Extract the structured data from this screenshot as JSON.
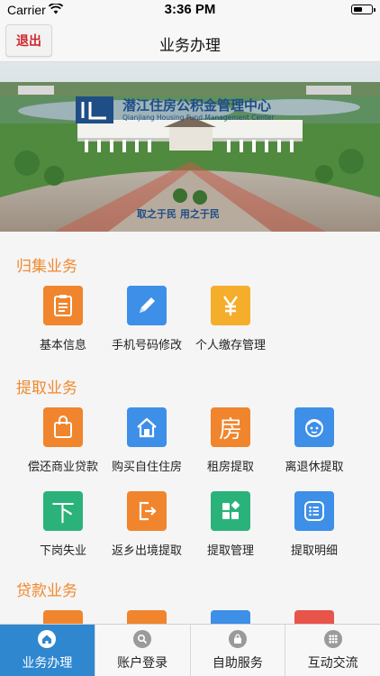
{
  "status_bar": {
    "carrier": "Carrier",
    "time": "3:36 PM"
  },
  "nav": {
    "back_label": "退出",
    "title": "业务办理"
  },
  "banner": {
    "center_name": "潜江住房公积金管理中心",
    "center_name_en": "Qianjiang Housing Fund Management Center",
    "slogan": "取之于民  用之于民"
  },
  "sections": {
    "collect": {
      "title": "归集业务",
      "items": [
        {
          "label": "基本信息",
          "icon": "clipboard-icon",
          "color": "#f0852d"
        },
        {
          "label": "手机号码修改",
          "icon": "pencil-icon",
          "color": "#3d8fe8"
        },
        {
          "label": "个人缴存管理",
          "icon": "yen-icon",
          "color": "#f5ad2c"
        }
      ]
    },
    "withdraw": {
      "title": "提取业务",
      "items": [
        {
          "label": "偿还商业贷款",
          "icon": "bag-icon",
          "color": "#f0852d"
        },
        {
          "label": "购买自住住房",
          "icon": "house-icon",
          "color": "#3d8fe8"
        },
        {
          "label": "租房提取",
          "icon": "rent-icon",
          "glyph": "房",
          "color": "#f0852d"
        },
        {
          "label": "离退休提取",
          "icon": "elder-icon",
          "color": "#3d8fe8"
        },
        {
          "label": "下岗失业",
          "icon": "down-icon",
          "glyph": "下",
          "color": "#2bb27a"
        },
        {
          "label": "返乡出境提取",
          "icon": "exit-icon",
          "color": "#f0852d"
        },
        {
          "label": "提取管理",
          "icon": "grid-apps-icon",
          "color": "#2bb27a"
        },
        {
          "label": "提取明细",
          "icon": "list-icon",
          "color": "#3d8fe8"
        }
      ]
    },
    "loan": {
      "title": "贷款业务",
      "items": [
        {
          "icon": "loan-icon-1",
          "color": "#f0852d"
        },
        {
          "icon": "loan-icon-2",
          "color": "#f0852d"
        },
        {
          "icon": "loan-icon-3",
          "color": "#3d8fe8"
        },
        {
          "icon": "loan-icon-4",
          "color": "#e8534a"
        }
      ]
    }
  },
  "tabs": [
    {
      "label": "业务办理",
      "icon": "home-icon",
      "active": true
    },
    {
      "label": "账户登录",
      "icon": "search-icon",
      "active": false
    },
    {
      "label": "自助服务",
      "icon": "bag-icon",
      "active": false
    },
    {
      "label": "互动交流",
      "icon": "apps-icon",
      "active": false
    }
  ],
  "colors": {
    "accent_orange": "#f0892e",
    "tab_active": "#2f87cf",
    "logout_red": "#d0262b"
  }
}
